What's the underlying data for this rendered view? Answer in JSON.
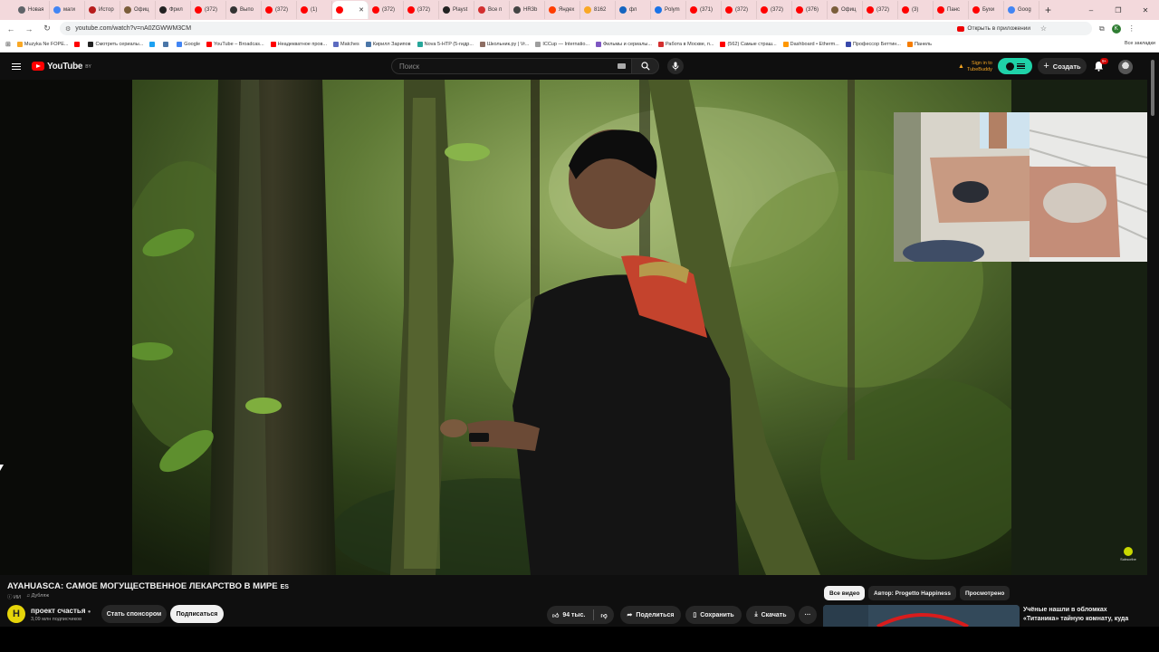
{
  "browser": {
    "tabs": [
      {
        "label": "Новая",
        "color": "#5f6368"
      },
      {
        "label": "маги",
        "color": "#4285f4"
      },
      {
        "label": "Истор",
        "color": "#b71c1c"
      },
      {
        "label": "Офиц",
        "color": "#7b5e3b"
      },
      {
        "label": "Фрил",
        "color": "#222222"
      },
      {
        "label": "(372)",
        "color": "#ff0000"
      },
      {
        "label": "Выпо",
        "color": "#333333"
      },
      {
        "label": "(372)",
        "color": "#ff0000"
      },
      {
        "label": "(1)",
        "color": "#ff0000"
      },
      {
        "label": "",
        "color": "#ff0000",
        "active": true
      },
      {
        "label": "(372)",
        "color": "#ff0000"
      },
      {
        "label": "(372)",
        "color": "#ff0000"
      },
      {
        "label": "Playst",
        "color": "#222222"
      },
      {
        "label": "Все п",
        "color": "#d32f2f"
      },
      {
        "label": "HR3b",
        "color": "#444444"
      },
      {
        "label": "Яндех",
        "color": "#ff3d00"
      },
      {
        "label": "8162",
        "color": "#f9a825"
      },
      {
        "label": "фл",
        "color": "#1565c0"
      },
      {
        "label": "Polym",
        "color": "#1a73e8"
      },
      {
        "label": "(371)",
        "color": "#ff0000"
      },
      {
        "label": "(372)",
        "color": "#ff0000"
      },
      {
        "label": "(372)",
        "color": "#ff0000"
      },
      {
        "label": "(376)",
        "color": "#ff0000"
      },
      {
        "label": "Офиц",
        "color": "#7b5e3b"
      },
      {
        "label": "(372)",
        "color": "#ff0000"
      },
      {
        "label": "(3)",
        "color": "#ff0000"
      },
      {
        "label": "Панс",
        "color": "#ff0000"
      },
      {
        "label": "Бухи",
        "color": "#ff0000"
      },
      {
        "label": "Goog",
        "color": "#4285f4"
      }
    ],
    "new_tab": "+",
    "window_controls": {
      "minimize": "–",
      "restore": "❐",
      "close": "✕"
    },
    "url": "youtube.com/watch?v=nA0ZGWWM3CM",
    "open_in_app": "Открыть в приложении",
    "profile_letter": "K",
    "bookmarks": [
      {
        "label": "Muzyka Ne FOPE...",
        "color": "#f9a825"
      },
      {
        "label": "",
        "color": "#ff0000"
      },
      {
        "label": "Смотреть сериалы...",
        "color": "#222222"
      },
      {
        "label": "",
        "color": "#1da1f2"
      },
      {
        "label": "",
        "color": "#4a76a8"
      },
      {
        "label": "Google",
        "color": "#4285f4"
      },
      {
        "label": "YouTube – Broadcas...",
        "color": "#ff0000"
      },
      {
        "label": "Неадекватное пров...",
        "color": "#ff0000"
      },
      {
        "label": "Matches",
        "color": "#5c6bc0"
      },
      {
        "label": "Кирилл Зарипов",
        "color": "#4a76a8"
      },
      {
        "label": "Nova 5-HTP (5-гидр...",
        "color": "#26a69a"
      },
      {
        "label": "Школьник.ру | Vr...",
        "color": "#8d6e63"
      },
      {
        "label": "ICCup — Internatio...",
        "color": "#9e9e9e"
      },
      {
        "label": "Фильмы и сериалы...",
        "color": "#7e57c2"
      },
      {
        "label": "Работа в Москве, п...",
        "color": "#d32f2f"
      },
      {
        "label": "(562) Самые страш...",
        "color": "#ff0000"
      },
      {
        "label": "Dashboard • Etherm...",
        "color": "#ff9800"
      },
      {
        "label": "Профессор Беттин...",
        "color": "#3949ab"
      },
      {
        "label": "Панель",
        "color": "#f57c00"
      }
    ],
    "all_bookmarks": "Все закладки"
  },
  "youtube": {
    "logo_text": "YouTube",
    "country_code": "BY",
    "search_placeholder": "Поиск",
    "tubebuddy_line1": "Sign in to",
    "tubebuddy_line2": "TubeBuddy",
    "create_label": "Создать",
    "notification_count": "9+"
  },
  "video": {
    "title": "AYAHUASCA: САМОЕ МОГУЩЕСТВЕННОЕ ЛЕКАРСТВО В МИРЕ",
    "title_badge": "ES",
    "ai_label": "ИИ",
    "dub_label": "Дубляж",
    "channel_name": "проект счастья",
    "channel_avatar_letter": "H",
    "subscribers": "3,09 млн подписчиков",
    "sponsor_label": "Стать спонсором",
    "subscribe_label": "Подписаться",
    "likes": "94 тыс.",
    "share_label": "Поделиться",
    "save_label": "Сохранить",
    "download_label": "Скачать",
    "more_label": "···",
    "watermark": "Subscribe"
  },
  "filters": [
    {
      "label": "Все видео",
      "active": true
    },
    {
      "label": "Автор: Progetto Happiness",
      "active": false
    },
    {
      "label": "Просмотрено",
      "active": false
    }
  ],
  "recommendation": {
    "title": "Учёные нашли в обломках «Титаника» тайную комнату, куда"
  },
  "colors": {
    "yt_background": "#0f0f0f",
    "accent_red": "#ff0000",
    "tubebuddy_green": "#1fd2a8",
    "tab_strip": "#f3d9dc"
  }
}
